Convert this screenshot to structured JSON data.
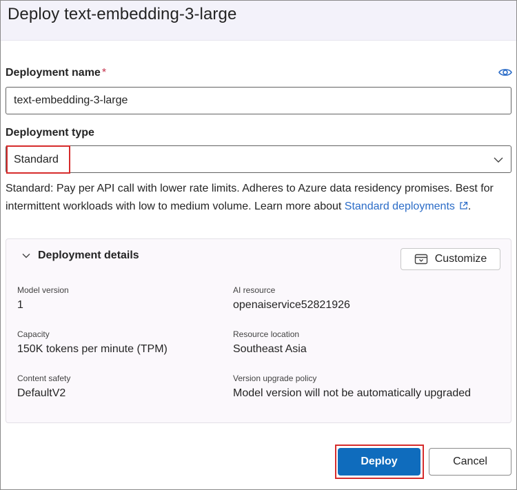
{
  "dialog": {
    "title": "Deploy text-embedding-3-large"
  },
  "deployment_name": {
    "label": "Deployment name",
    "required_mark": "*",
    "value": "text-embedding-3-large"
  },
  "deployment_type": {
    "label": "Deployment type",
    "selected": "Standard"
  },
  "description": {
    "text": "Standard: Pay per API call with lower rate limits. Adheres to Azure data residency promises. Best for intermittent workloads with low to medium volume. Learn more about ",
    "link_text": "Standard deployments",
    "suffix": "."
  },
  "details": {
    "toggle_label": "Deployment details",
    "customize_label": "Customize",
    "properties": [
      {
        "key": "Model version",
        "value": "1"
      },
      {
        "key": "AI resource",
        "value": "openaiservice52821926"
      },
      {
        "key": "Capacity",
        "value": "150K tokens per minute (TPM)"
      },
      {
        "key": "Resource location",
        "value": "Southeast Asia"
      },
      {
        "key": "Content safety",
        "value": "DefaultV2"
      },
      {
        "key": "Version upgrade policy",
        "value": "Model version will not be automatically upgraded"
      }
    ]
  },
  "footer": {
    "deploy_label": "Deploy",
    "cancel_label": "Cancel"
  },
  "colors": {
    "primary": "#0f6cbd",
    "link": "#2b6cc7",
    "highlight": "#d62b2b",
    "header_bg": "#f3f2fa"
  }
}
